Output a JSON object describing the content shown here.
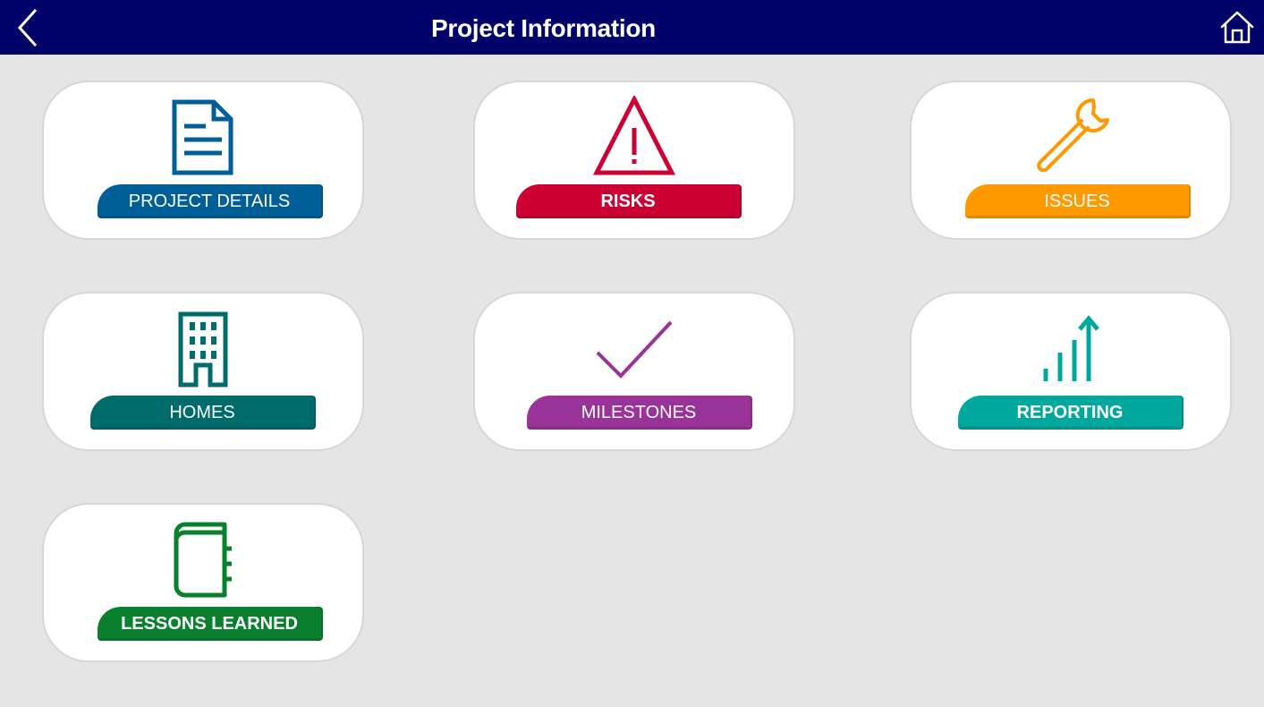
{
  "header": {
    "title": "Project Information",
    "back_icon": "chevron-left-icon",
    "home_icon": "home-icon",
    "background": "#01016a"
  },
  "tiles": [
    {
      "label": "PROJECT DETAILS",
      "icon": "document-icon",
      "color": "#005f96"
    },
    {
      "label": "RISKS",
      "icon": "warning-icon",
      "color": "#cc0033"
    },
    {
      "label": "ISSUES",
      "icon": "wrench-icon",
      "color": "#ff9900"
    },
    {
      "label": "HOMES",
      "icon": "building-icon",
      "color": "#006b6b"
    },
    {
      "label": "MILESTONES",
      "icon": "checkmark-icon",
      "color": "#993399"
    },
    {
      "label": "REPORTING",
      "icon": "bar-chart-up-icon",
      "color": "#00a79d"
    },
    {
      "label": "LESSONS LEARNED",
      "icon": "notebook-icon",
      "color": "#0a7f2e"
    }
  ]
}
